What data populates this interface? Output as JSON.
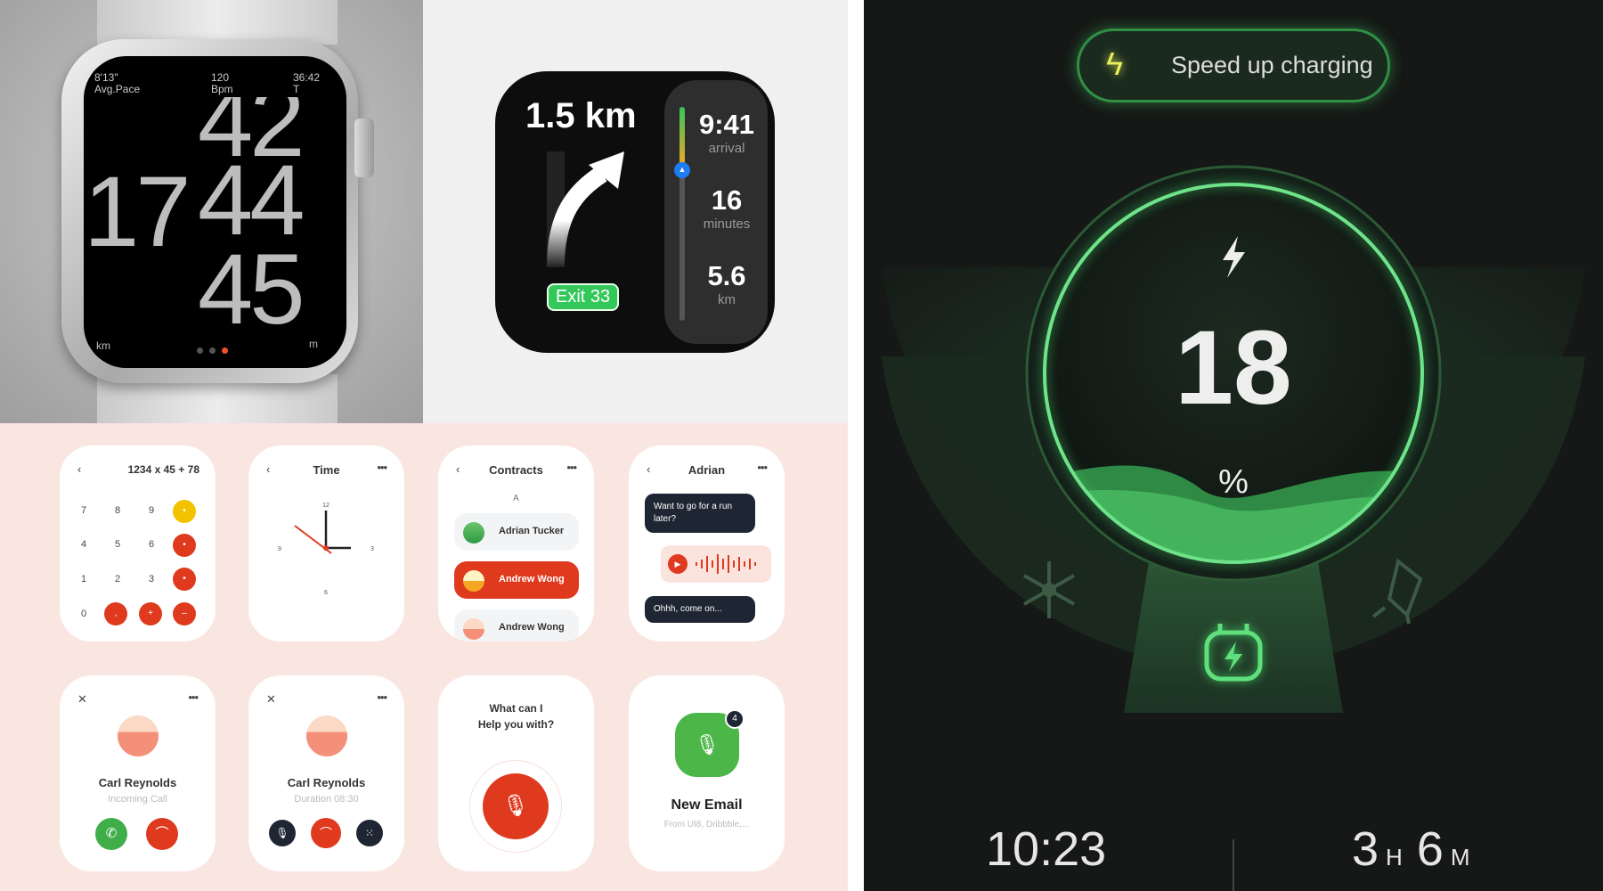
{
  "running_watch": {
    "pace_value": "8'13\"",
    "pace_label": "Avg.Pace",
    "bpm_value": "120",
    "bpm_label": "Bpm",
    "time_value": "36:42",
    "time_label": "T",
    "digits_left": "17",
    "digits_top": "42",
    "digits_mid": "44",
    "digits_bottom": "45",
    "unit_left": "km",
    "unit_right": "m",
    "active_page": 3,
    "page_count": 3,
    "accent": "#f0512a"
  },
  "navigation": {
    "distance": "1.5 km",
    "exit_label": "Exit 33",
    "arrival_value": "9:41",
    "arrival_label": "arrival",
    "minutes_value": "16",
    "minutes_label": "minutes",
    "remaining_value": "5.6",
    "remaining_label": "km",
    "exit_color": "#34c759"
  },
  "mini_apps": {
    "calculator": {
      "expression": "1234 x 45 + 78",
      "keys": [
        "7",
        "8",
        "9",
        "4",
        "5",
        "6",
        "1",
        "2",
        "3",
        "0"
      ]
    },
    "clock": {
      "title": "Time",
      "marks": [
        "12",
        "3",
        "6",
        "9"
      ]
    },
    "contacts": {
      "title": "Contracts",
      "section": "A",
      "items": [
        {
          "name": "Adrian Tucker"
        },
        {
          "name": "Andrew Wong",
          "selected": true
        },
        {
          "name": "Andrew Wong"
        }
      ]
    },
    "chat": {
      "title": "Adrian",
      "message1": "Want to go for a run later?",
      "message2": "Ohhh, come on..."
    },
    "incoming_call": {
      "name": "Carl Reynolds",
      "status": "Incoming Call"
    },
    "active_call": {
      "name": "Carl Reynolds",
      "status": "Duration 08:30"
    },
    "assistant": {
      "prompt_line1": "What can I",
      "prompt_line2": "Help you with?"
    },
    "email": {
      "badge": "4",
      "title": "New Email",
      "preview": "From UI8, Dribbble,..."
    },
    "accent": "#e03a1e"
  },
  "charging": {
    "button_label": "Speed up charging",
    "percent_value": "18",
    "percent_symbol": "%",
    "clock": "10:23",
    "remaining_h": "3",
    "h_label": "H",
    "remaining_m": "6",
    "m_label": "M",
    "battery_level": 18,
    "accent": "#3fbf5f"
  }
}
